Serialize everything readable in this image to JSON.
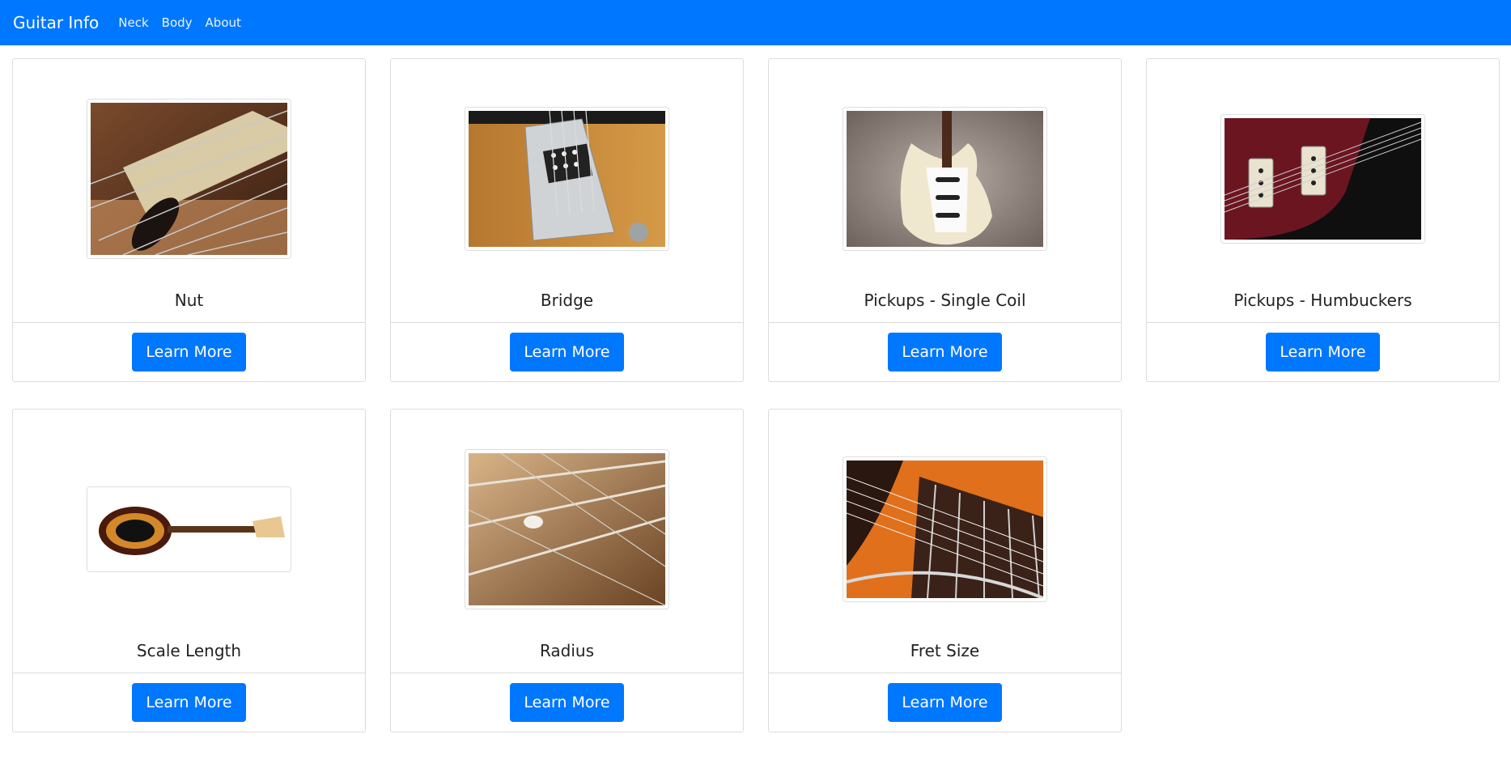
{
  "navbar": {
    "brand": "Guitar Info",
    "links": [
      "Neck",
      "Body",
      "About"
    ]
  },
  "cards": [
    {
      "title": "Nut",
      "button": "Learn More",
      "image": "guitar-nut-photo"
    },
    {
      "title": "Bridge",
      "button": "Learn More",
      "image": "telecaster-bridge-photo"
    },
    {
      "title": "Pickups - Single Coil",
      "button": "Learn More",
      "image": "stratocaster-single-coil-photo"
    },
    {
      "title": "Pickups - Humbuckers",
      "button": "Learn More",
      "image": "humbucker-pickups-photo"
    },
    {
      "title": "Scale Length",
      "button": "Learn More",
      "image": "sunburst-electric-guitar-photo"
    },
    {
      "title": "Radius",
      "button": "Learn More",
      "image": "fretboard-closeup-photo"
    },
    {
      "title": "Fret Size",
      "button": "Learn More",
      "image": "acoustic-frets-photo"
    }
  ],
  "colors": {
    "primary": "#0077ff",
    "border": "#dcdcdc"
  }
}
